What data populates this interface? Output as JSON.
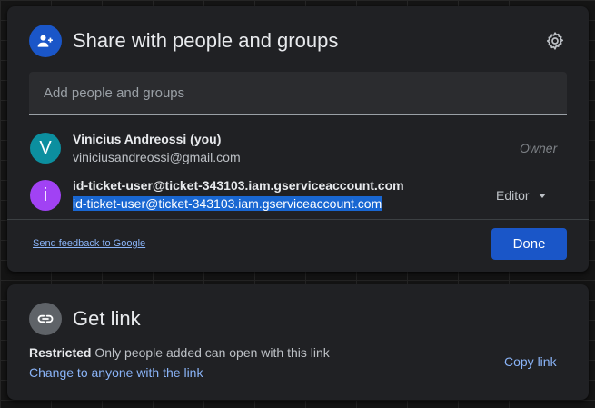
{
  "share": {
    "title": "Share with people and groups",
    "header_icon": "person-add-icon",
    "settings_icon": "gear-icon",
    "add_placeholder": "Add people and groups",
    "people": [
      {
        "initial": "V",
        "avatar_color": "#0c8f9f",
        "name": "Vinicius Andreossi (you)",
        "email": "viniciusandreossi@gmail.com",
        "role": "Owner"
      },
      {
        "initial": "i",
        "avatar_color": "#a142f4",
        "name": "id-ticket-user@ticket-343103.iam.gserviceaccount.com",
        "email": "id-ticket-user@ticket-343103.iam.gserviceaccount.com",
        "role": "Editor",
        "role_icon": "caret-down-icon"
      }
    ],
    "feedback_link": "Send feedback to Google",
    "done_label": "Done"
  },
  "link": {
    "title": "Get link",
    "header_icon": "link-icon",
    "restricted_label": "Restricted",
    "restricted_desc": "Only people added can open with this link",
    "change_link": "Change to anyone with the link",
    "copy_link": "Copy link"
  },
  "colors": {
    "accent": "#1a56c8",
    "link": "#8ab4f8",
    "card_bg": "#202124",
    "text_selection": "#1967d2"
  }
}
